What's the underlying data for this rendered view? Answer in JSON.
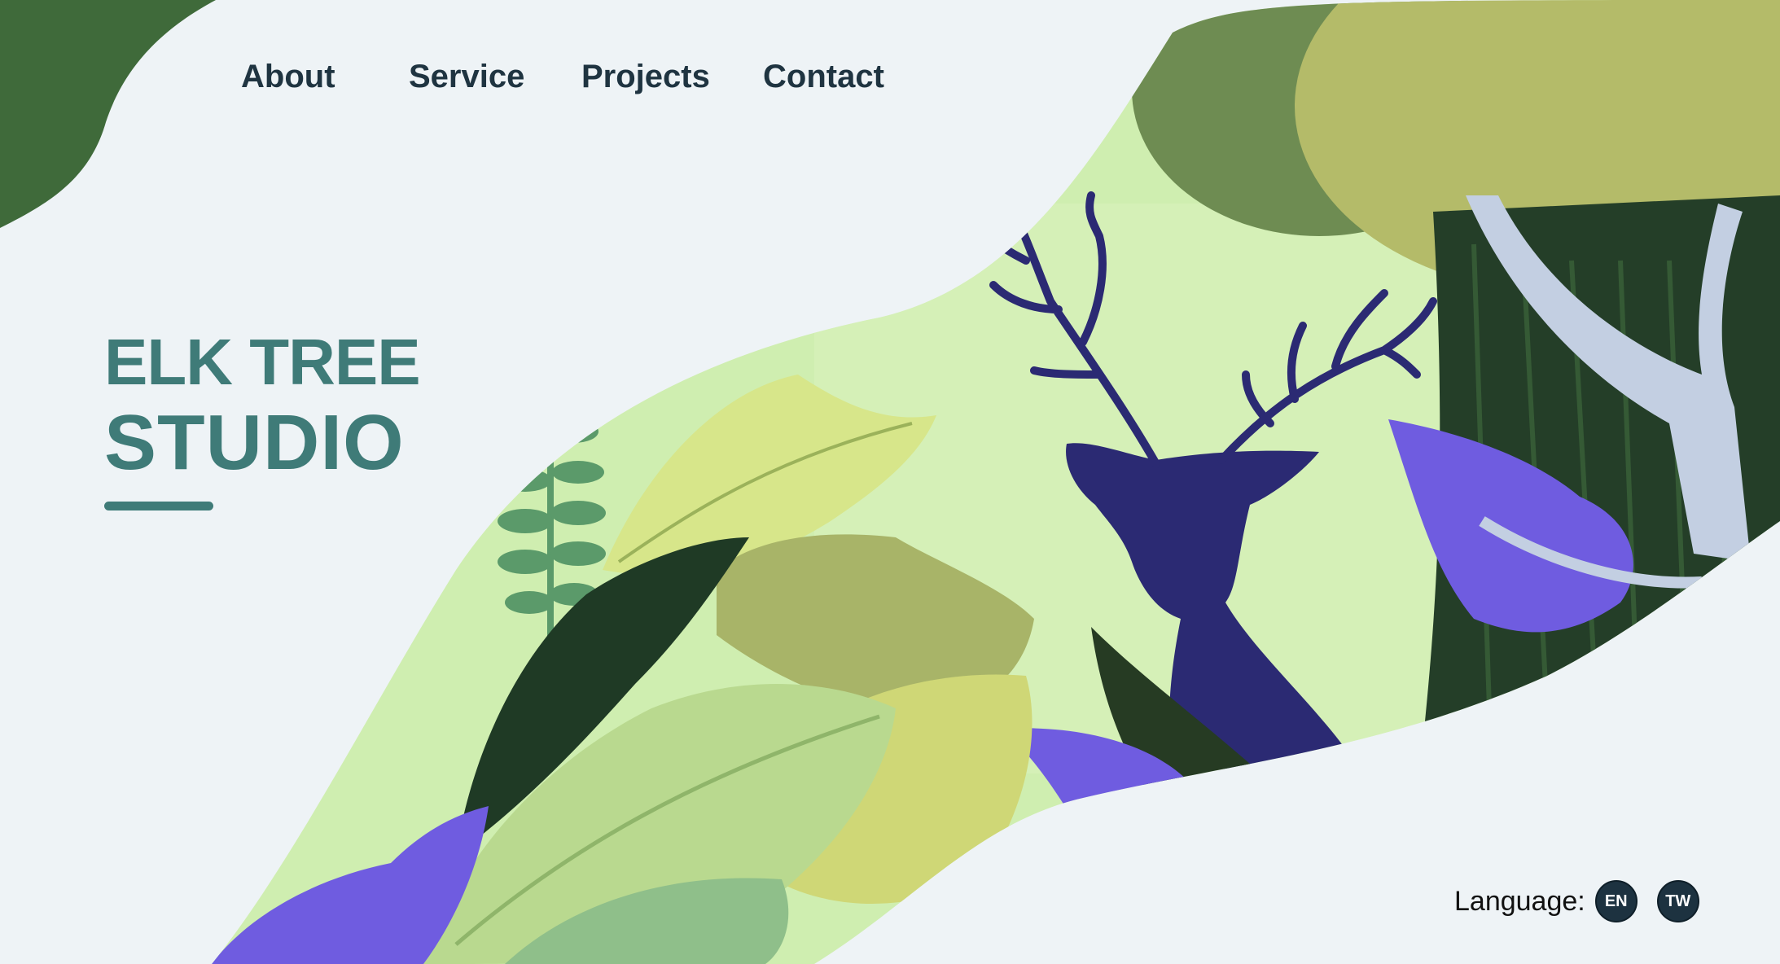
{
  "nav": {
    "items": [
      {
        "label": "About"
      },
      {
        "label": "Service"
      },
      {
        "label": "Projects"
      },
      {
        "label": "Contact"
      }
    ]
  },
  "brand": {
    "line1": "ELK TREE",
    "line2": "STUDIO"
  },
  "language": {
    "label": "Language:",
    "options": [
      "EN",
      "TW"
    ]
  },
  "colors": {
    "background": "#eef3f6",
    "brand": "#3f7b78",
    "nav_text": "#1f3441",
    "elk": "#2b2a73",
    "purple_leaf": "#6a55d8",
    "light_green": "#cfeeb0",
    "dark_green": "#1f3a25"
  },
  "illustration": {
    "icon": "elk-forest-illustration"
  }
}
